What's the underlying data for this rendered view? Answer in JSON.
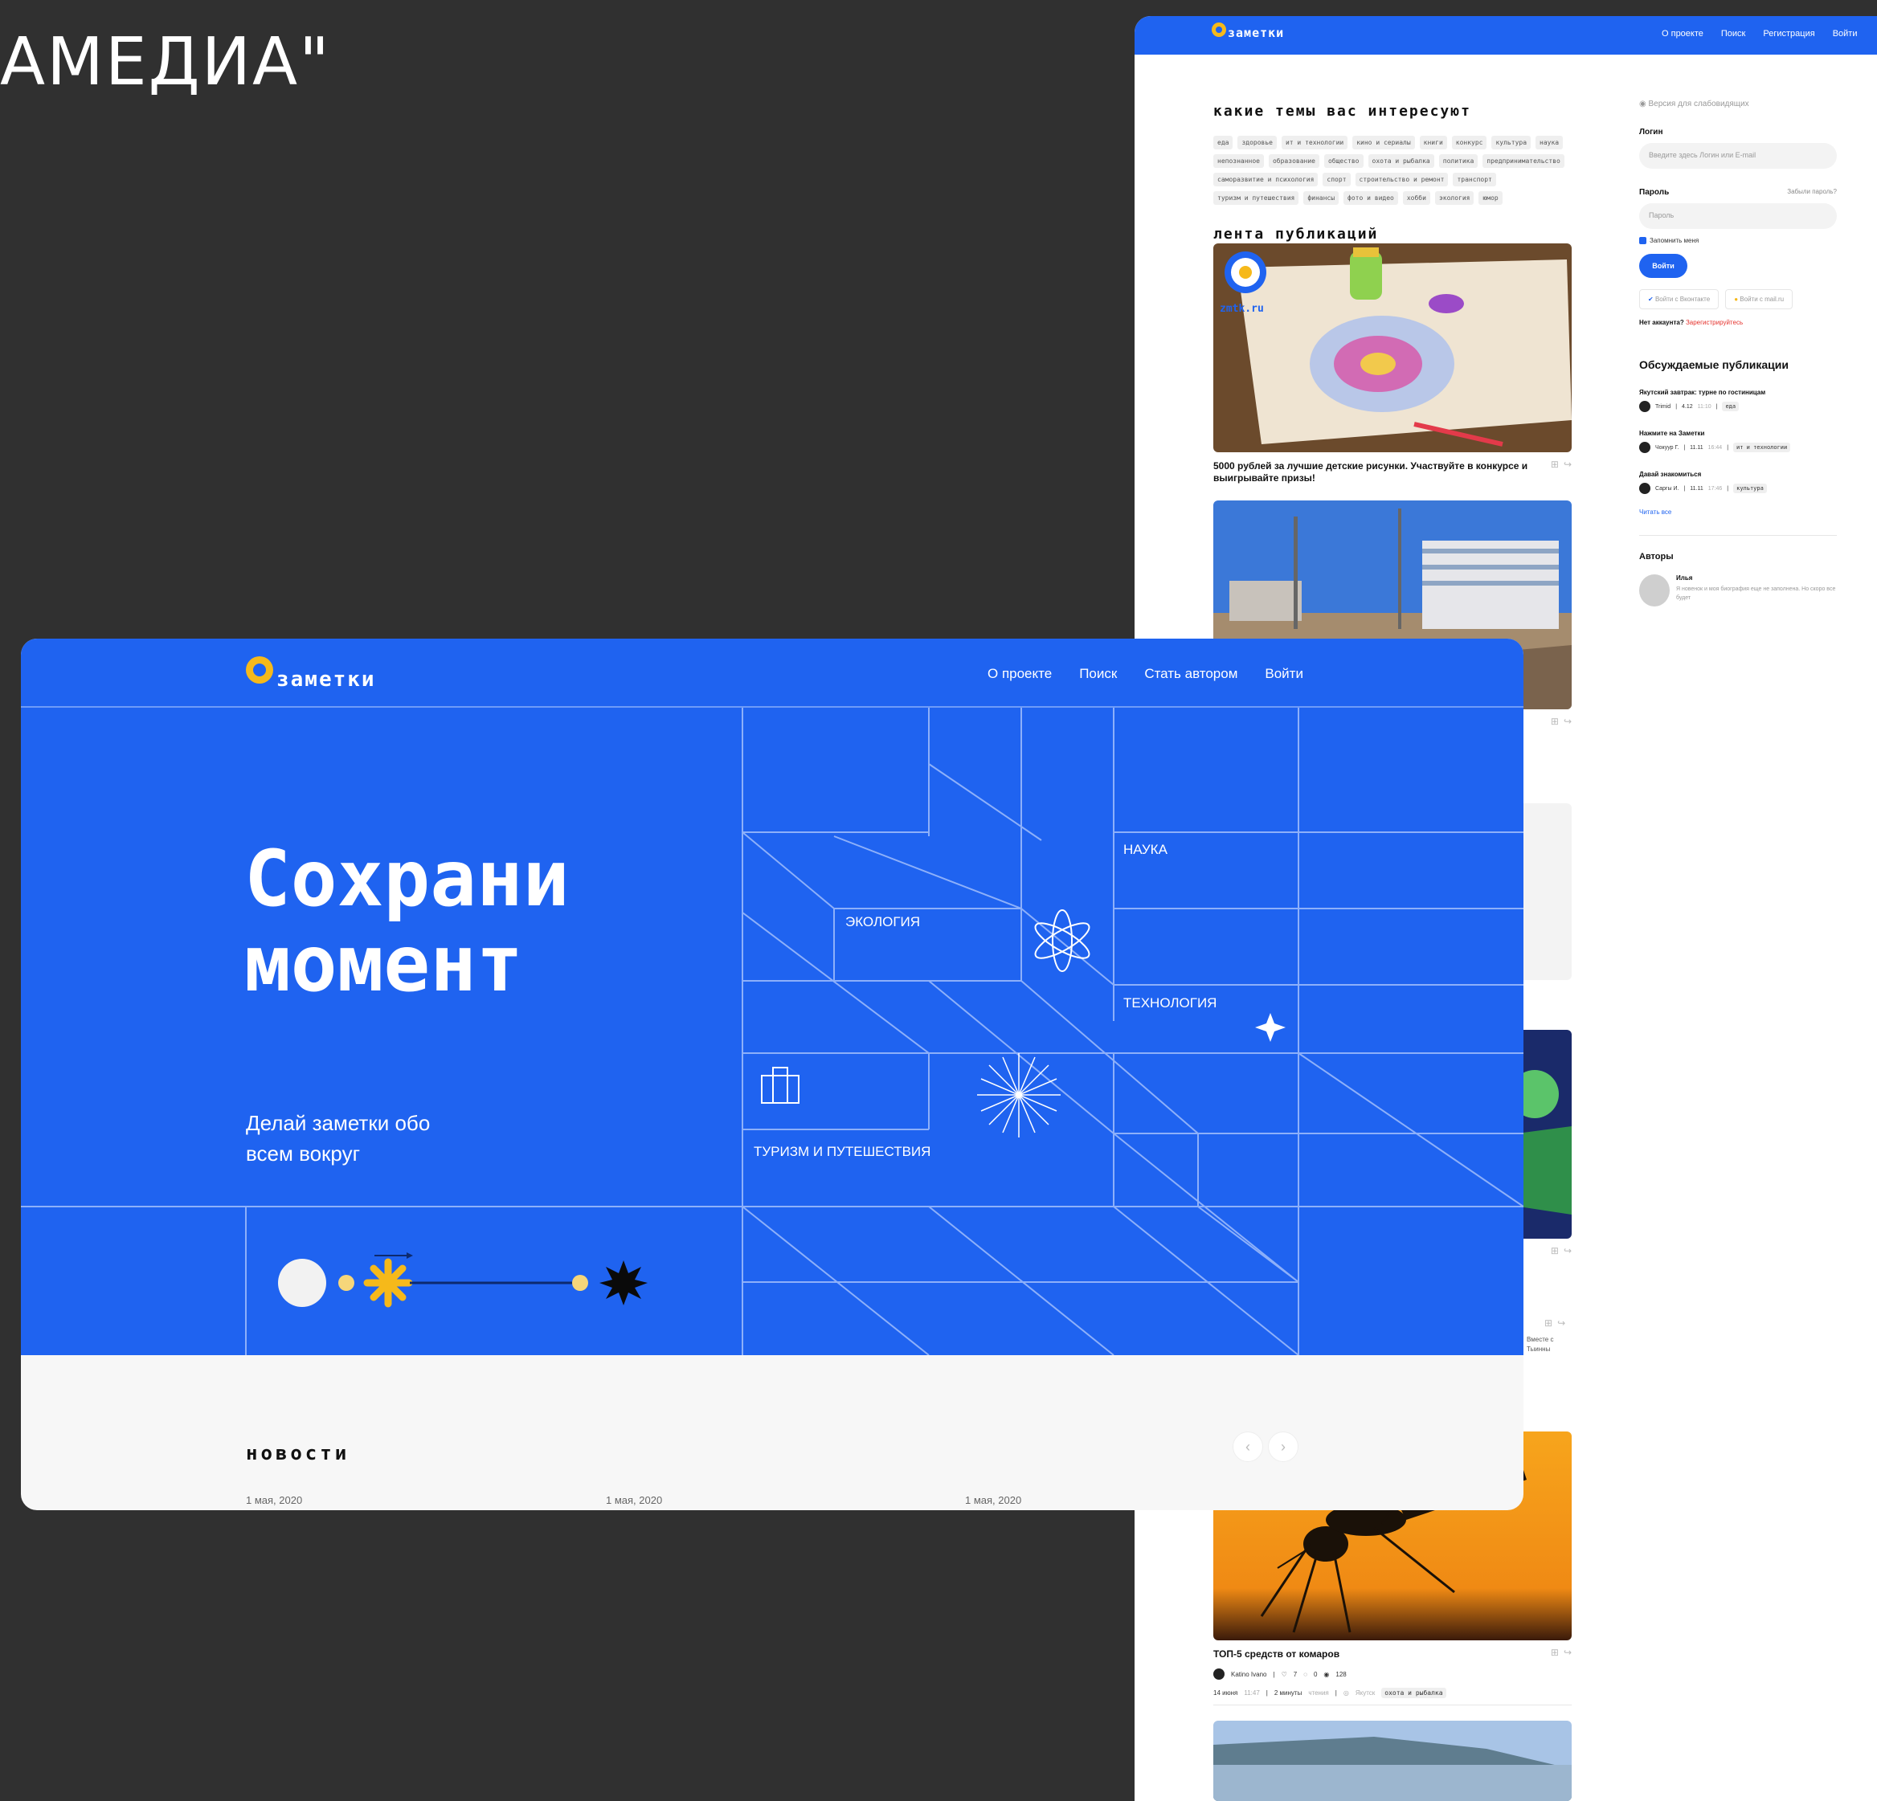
{
  "brand_text": "АМЕДИА\"",
  "site": {
    "logo_text": "заметки"
  },
  "right_window": {
    "nav": [
      "О проекте",
      "Поиск",
      "Регистрация",
      "Войти"
    ],
    "topics_title": "какие темы вас интересуют",
    "tags": [
      "еда",
      "здоровье",
      "ит и технологии",
      "кино и сериалы",
      "книги",
      "конкурс",
      "культура",
      "наука",
      "непознанное",
      "образование",
      "общество",
      "охота и рыбалка",
      "политика",
      "предпринимательство",
      "саморазвитие и психология",
      "спорт",
      "строительство и ремонт",
      "транспорт",
      "туризм и путешествия",
      "финансы",
      "фото и видео",
      "хобби",
      "экология",
      "юмор"
    ],
    "feed_title": "лента публикаций",
    "card1": {
      "title": "5000 рублей за лучшие детские рисунки. Участвуйте в конкурсе и выигрывайте призы!",
      "badge": "zmtk.ru"
    },
    "partial_text": "Вместе с Тыинны",
    "card_mosquito": {
      "title": "ТОП-5 средств от комаров",
      "author": "Katino Ivano",
      "likes": "7",
      "comments": "0",
      "views": "128",
      "date": "14 июня",
      "time": "11:47",
      "read_time": "2 минуты",
      "read_label": "чтения",
      "location": "Якутск",
      "tag": "охота и рыбалка"
    },
    "sidebar": {
      "accessibility": "Версия для слабовидящих",
      "login_label": "Логин",
      "login_placeholder": "Введите здесь Логин или E-mail",
      "password_label": "Пароль",
      "forgot": "Забыли пароль?",
      "password_placeholder": "Пароль",
      "remember": "Запомнить меня",
      "login_button": "Войти",
      "vk": "Войти с Вконтакте",
      "mailru": "Войти с mail.ru",
      "no_account": "Нет аккаунта?",
      "register": "Зарегистрируйтесь",
      "discussed_title": "Обсуждаемые публикации",
      "discussed": [
        {
          "title": "Якутский завтрак: турне по гостиницам",
          "author": "Trimid",
          "date": "4.12",
          "time": "11:10",
          "tag": "еда"
        },
        {
          "title": "Нажмите на Заметки",
          "author": "Чокуур Г.",
          "date": "11.11",
          "time": "16:44",
          "tag": "ит и технологии"
        },
        {
          "title": "Давай знакомиться",
          "author": "Саргы И.",
          "date": "11.11",
          "time": "17:46",
          "tag": "культура"
        }
      ],
      "read_all": "Читать все",
      "authors_title": "Авторы",
      "author_name": "Илья",
      "author_bio": "Я новенок и моя биография еще не заполнена. Но скоро все будет"
    }
  },
  "left_window": {
    "nav": [
      "О проекте",
      "Поиск",
      "Стать автором",
      "Войти"
    ],
    "hero_title_1": "Сохрани",
    "hero_title_2": "момент",
    "hero_sub_1": "Делай заметки обо",
    "hero_sub_2": "всем вокруг",
    "grid_labels": {
      "science": "НАУКА",
      "ecology": "ЭКОЛОГИЯ",
      "technology": "ТЕХНОЛОГИЯ",
      "tourism": "ТУРИЗМ И ПУТЕШЕСТВИЯ"
    },
    "news_title": "новости",
    "news_dates": [
      "1 мая, 2020",
      "1 мая, 2020",
      "1 мая, 2020"
    ]
  },
  "colors": {
    "brand_blue": "#1f63f0",
    "accent_yellow": "#f6b91a",
    "background": "#303030"
  }
}
